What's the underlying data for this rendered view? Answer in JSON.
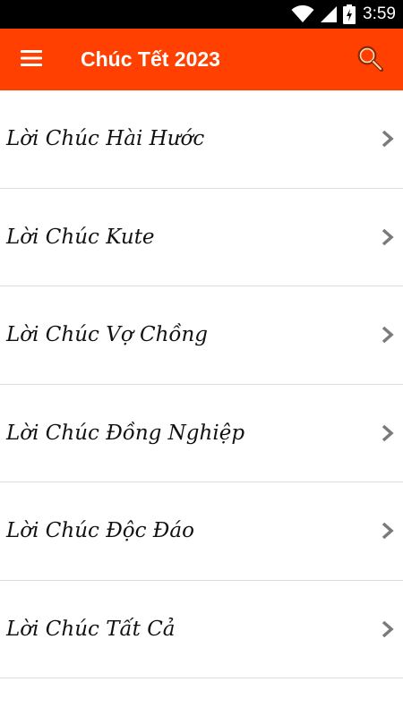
{
  "status_bar": {
    "time": "3:59",
    "icons": [
      "wifi-icon",
      "signal-icon",
      "battery-charging-icon"
    ]
  },
  "app_bar": {
    "title": "Chúc Tết 2023",
    "background": "#ff4000",
    "menu_icon": "menu-icon",
    "search_icon": "search-icon"
  },
  "list": {
    "items": [
      {
        "label": "Lời Chúc Hài Hước"
      },
      {
        "label": "Lời Chúc Kute"
      },
      {
        "label": "Lời Chúc Vợ Chồng"
      },
      {
        "label": "Lời Chúc Đồng Nghiệp"
      },
      {
        "label": "Lời Chúc Độc Đáo"
      },
      {
        "label": "Lời Chúc Tất Cả"
      }
    ],
    "chevron_icon": "chevron-right-icon"
  }
}
